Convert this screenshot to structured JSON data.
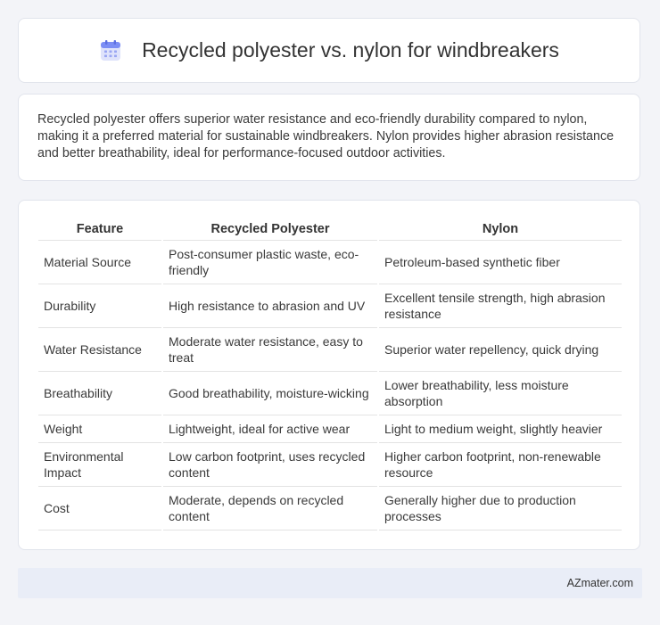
{
  "header": {
    "title": "Recycled polyester vs. nylon for windbreakers",
    "icon": "calendar-icon"
  },
  "intro": {
    "text": "Recycled polyester offers superior water resistance and eco-friendly durability compared to nylon, making it a preferred material for sustainable windbreakers. Nylon provides higher abrasion resistance and better breathability, ideal for performance-focused outdoor activities."
  },
  "table": {
    "headers": [
      "Feature",
      "Recycled Polyester",
      "Nylon"
    ],
    "rows": [
      [
        "Material Source",
        "Post-consumer plastic waste, eco-friendly",
        "Petroleum-based synthetic fiber"
      ],
      [
        "Durability",
        "High resistance to abrasion and UV",
        "Excellent tensile strength, high abrasion resistance"
      ],
      [
        "Water Resistance",
        "Moderate water resistance, easy to treat",
        "Superior water repellency, quick drying"
      ],
      [
        "Breathability",
        "Good breathability, moisture-wicking",
        "Lower breathability, less moisture absorption"
      ],
      [
        "Weight",
        "Lightweight, ideal for active wear",
        "Light to medium weight, slightly heavier"
      ],
      [
        "Environmental Impact",
        "Low carbon footprint, uses recycled content",
        "Higher carbon footprint, non-renewable resource"
      ],
      [
        "Cost",
        "Moderate, depends on recycled content",
        "Generally higher due to production processes"
      ]
    ]
  },
  "footer": {
    "text": "AZmater.com"
  }
}
